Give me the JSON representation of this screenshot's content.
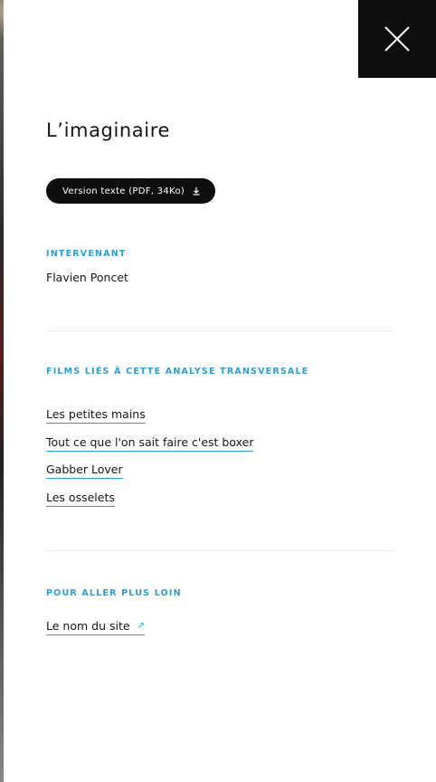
{
  "panel": {
    "title": "L’imaginaire",
    "pdf_button": {
      "label": "Version texte (PDF, 34Ko)",
      "icon": "download-icon"
    },
    "close_icon": "close-icon"
  },
  "intervenant": {
    "heading": "INTERVENANT",
    "name": "Flavien Poncet"
  },
  "films": {
    "heading": "FILMS LIÉS À CETTE ANALYSE TRANSVERSALE",
    "items": [
      {
        "label": "Les petites mains"
      },
      {
        "label": "Tout ce que l'on sait faire c'est boxer"
      },
      {
        "label": "Gabber Lover"
      },
      {
        "label": "Les osselets"
      }
    ]
  },
  "further": {
    "heading": "POUR ALLER PLUS LOIN",
    "link_label": "Le nom du site",
    "link_icon": "external-link-icon"
  },
  "colors": {
    "accent": "#2a9fd0",
    "dark": "#0e0e0e",
    "text": "#161616"
  }
}
